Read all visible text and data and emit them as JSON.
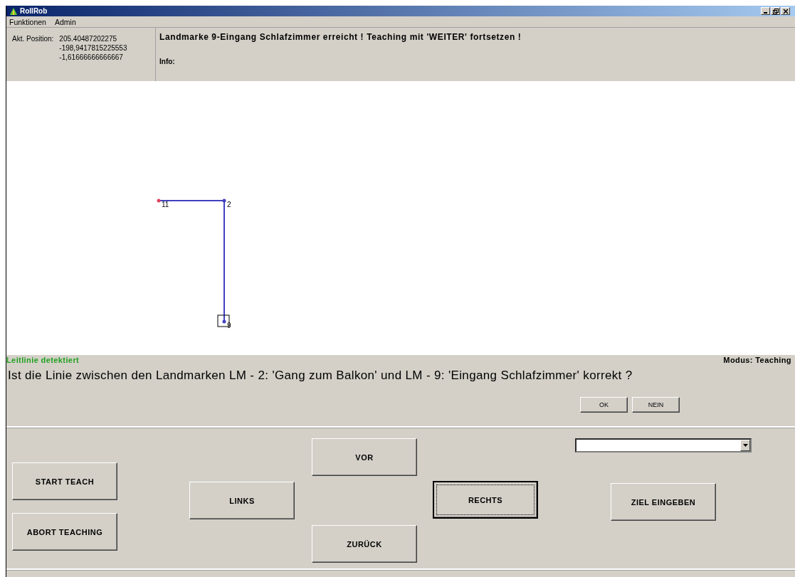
{
  "window": {
    "title": "RollRob"
  },
  "menu": [
    {
      "label": "Funktionen"
    },
    {
      "label": "Admin"
    }
  ],
  "position": {
    "label": "Akt. Position:",
    "values": [
      "205.40487202275",
      "-198,9417815225553",
      "-1,61666666666667"
    ]
  },
  "message": {
    "text": "Landmarke 9-Eingang Schlafzimmer erreicht ! Teaching mit 'WEITER' fortsetzen !",
    "info_label": "Info:"
  },
  "map": {
    "nodes": [
      {
        "label": "11",
        "start": true
      },
      {
        "label": "2",
        "start": false
      },
      {
        "label": "9",
        "start": false
      }
    ]
  },
  "status": {
    "left": "Leitlinie detektiert",
    "right": "Modus: Teaching"
  },
  "question": {
    "text": "Ist die Linie zwischen den Landmarken LM - 2: 'Gang zum Balkon' und LM - 9: 'Eingang Schlafzimmer' korrekt ?",
    "buttons": [
      {
        "label": "OK"
      },
      {
        "label": "NEIN"
      }
    ]
  },
  "controls": [
    {
      "label": "START TEACH",
      "focused": false
    },
    {
      "label": "ABORT TEACHING",
      "focused": false
    },
    {
      "label": "LINKS",
      "focused": false
    },
    {
      "label": "VOR",
      "focused": false
    },
    {
      "label": "ZURÜCK",
      "focused": false
    },
    {
      "label": "RECHTS",
      "focused": true
    },
    {
      "label": "ZIEL EINGEBEN",
      "focused": false
    }
  ]
}
